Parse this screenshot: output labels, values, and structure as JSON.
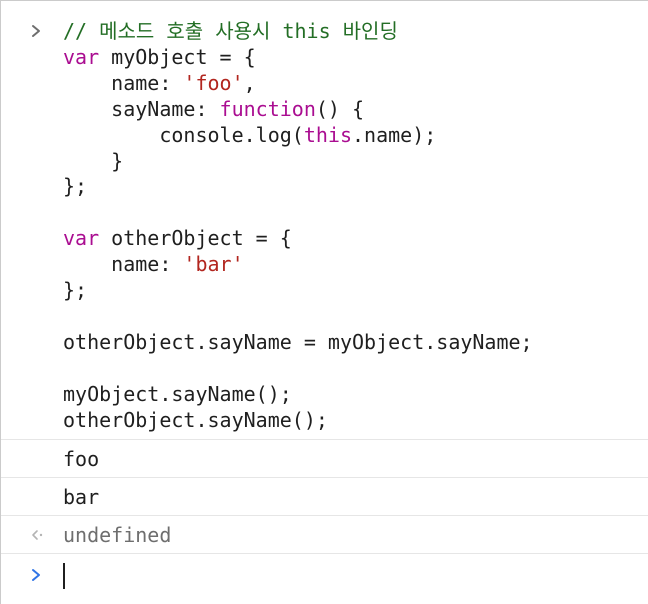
{
  "console": {
    "input_block": {
      "lines": [
        [
          {
            "t": "// 메소드 호출 사용시 this 바인딩",
            "c": "comment"
          }
        ],
        [
          {
            "t": "var",
            "c": "kw"
          },
          {
            "t": " myObject = {",
            "c": "plain"
          }
        ],
        [
          {
            "t": "    name: ",
            "c": "plain"
          },
          {
            "t": "'foo'",
            "c": "str"
          },
          {
            "t": ",",
            "c": "plain"
          }
        ],
        [
          {
            "t": "    sayName: ",
            "c": "plain"
          },
          {
            "t": "function",
            "c": "kw"
          },
          {
            "t": "() {",
            "c": "plain"
          }
        ],
        [
          {
            "t": "        console.log(",
            "c": "plain"
          },
          {
            "t": "this",
            "c": "kw"
          },
          {
            "t": ".name);",
            "c": "plain"
          }
        ],
        [
          {
            "t": "    }",
            "c": "plain"
          }
        ],
        [
          {
            "t": "};",
            "c": "plain"
          }
        ],
        [
          {
            "t": "",
            "c": "plain"
          }
        ],
        [
          {
            "t": "var",
            "c": "kw"
          },
          {
            "t": " otherObject = {",
            "c": "plain"
          }
        ],
        [
          {
            "t": "    name: ",
            "c": "plain"
          },
          {
            "t": "'bar'",
            "c": "str"
          }
        ],
        [
          {
            "t": "};",
            "c": "plain"
          }
        ],
        [
          {
            "t": "",
            "c": "plain"
          }
        ],
        [
          {
            "t": "otherObject.sayName = myObject.sayName;",
            "c": "plain"
          }
        ],
        [
          {
            "t": "",
            "c": "plain"
          }
        ],
        [
          {
            "t": "myObject.sayName();",
            "c": "plain"
          }
        ],
        [
          {
            "t": "otherObject.sayName();",
            "c": "plain"
          }
        ]
      ]
    },
    "outputs": [
      {
        "text": "foo"
      },
      {
        "text": "bar"
      }
    ],
    "return_value": "undefined",
    "prompt_value": ""
  },
  "colors": {
    "comment": "#236e25",
    "keyword": "#aa0d91",
    "string": "#b2261f",
    "text": "#1f1f1f",
    "return_text": "#6e6e6e",
    "prompt_chevron": "#2f74e6",
    "input_chevron": "#6e6e6e"
  },
  "icons": {
    "input_marker": "chevron-right-icon",
    "return_marker": "return-arrow-icon",
    "prompt_marker": "prompt-chevron-icon"
  }
}
